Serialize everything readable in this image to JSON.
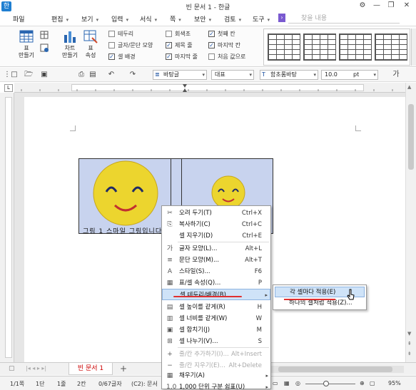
{
  "window": {
    "title": "빈 문서 1 - 한글",
    "controls": [
      "⚙",
      "—",
      "❐",
      "✕"
    ]
  },
  "menu": {
    "items": [
      "파일",
      "편집",
      "보기",
      "입력",
      "서식",
      "쪽",
      "보안",
      "검토",
      "도구"
    ],
    "search_placeholder": "찾을 내용"
  },
  "ribbon": {
    "make_table": "표\n만들기",
    "make_chart": "차트\n만들기",
    "table_props": "표\n속성",
    "checks_col1": [
      {
        "label": "테두리",
        "checked": false
      },
      {
        "label": "글자/문단 모양",
        "checked": false
      },
      {
        "label": "셀 배경",
        "checked": true
      }
    ],
    "checks_col2": [
      {
        "label": "회색조",
        "checked": false
      },
      {
        "label": "제목 줄",
        "checked": true
      },
      {
        "label": "마지막 줄",
        "checked": true
      }
    ],
    "checks_col3": [
      {
        "label": "첫째 칸",
        "checked": true
      },
      {
        "label": "마지막 칸",
        "checked": true
      },
      {
        "label": "처음 값으로",
        "checked": false
      }
    ]
  },
  "format": {
    "style": "바탕글",
    "lang": "대표",
    "font": "함초롬바탕",
    "size": "10.0",
    "unit": "pt"
  },
  "doc": {
    "caption": "그림 1  스마일 그림입니다"
  },
  "context_menu": {
    "items": [
      {
        "icon": "scissors-icon",
        "glyph": "✂",
        "label": "오려 두기(T)",
        "shortcut": "Ctrl+X",
        "disabled": false
      },
      {
        "icon": "copy-icon",
        "glyph": "⎘",
        "label": "복사하기(C)",
        "shortcut": "Ctrl+C",
        "disabled": false
      },
      {
        "icon": "",
        "glyph": "",
        "label": "셀 지우기(D)",
        "shortcut": "Ctrl+E",
        "disabled": false
      },
      {
        "icon": "char-shape-icon",
        "glyph": "가",
        "label": "글자 모양(L)...",
        "shortcut": "Alt+L",
        "disabled": false
      },
      {
        "icon": "para-shape-icon",
        "glyph": "≡",
        "label": "문단 모양(M)...",
        "shortcut": "Alt+T",
        "disabled": false
      },
      {
        "icon": "style-icon",
        "glyph": "A",
        "label": "스타일(S)...",
        "shortcut": "F6",
        "disabled": false
      },
      {
        "icon": "table-props-icon",
        "glyph": "▦",
        "label": "표/셀 속성(Q)...",
        "shortcut": "P",
        "disabled": false
      },
      {
        "icon": "",
        "glyph": "",
        "label": "셀 테두리/배경(B)",
        "shortcut": "",
        "disabled": false
      },
      {
        "icon": "equal-height-icon",
        "glyph": "▤",
        "label": "셀 높이를 같게(R)",
        "shortcut": "H",
        "disabled": false
      },
      {
        "icon": "equal-width-icon",
        "glyph": "▥",
        "label": "셀 너비를 같게(W)",
        "shortcut": "W",
        "disabled": false
      },
      {
        "icon": "merge-cells-icon",
        "glyph": "▣",
        "label": "셀 합치기(J)",
        "shortcut": "M",
        "disabled": false
      },
      {
        "icon": "split-cells-icon",
        "glyph": "⊞",
        "label": "셀 나누기(V)...",
        "shortcut": "S",
        "disabled": false
      },
      {
        "icon": "add-row-icon",
        "glyph": "+",
        "label": "줄/칸 추가하기(I)...",
        "shortcut": "Alt+Insert",
        "disabled": true
      },
      {
        "icon": "delete-row-icon",
        "glyph": "−",
        "label": "줄/칸 지우기(E)...",
        "shortcut": "Alt+Delete",
        "disabled": true
      },
      {
        "icon": "fill-icon",
        "glyph": "▦",
        "label": "채우기(A)",
        "shortcut": "",
        "disabled": false
      },
      {
        "icon": "thousand-sep-icon",
        "glyph": "1,0",
        "label": "1,000 단위 구분 쉼표(U)",
        "shortcut": "",
        "disabled": false
      }
    ],
    "submenu": [
      "각 셀마다 적용(E)",
      "하나의 셀처럼 적용(Z)..."
    ]
  },
  "tabs": {
    "doc_tab": "빈 문서 1",
    "add": "+"
  },
  "status": {
    "page": "1/1쪽",
    "section": "1단",
    "line": "1줄",
    "col": "2칸",
    "chars": "0/67글자",
    "cell": "(C2): 문서",
    "zoom": "95%"
  }
}
